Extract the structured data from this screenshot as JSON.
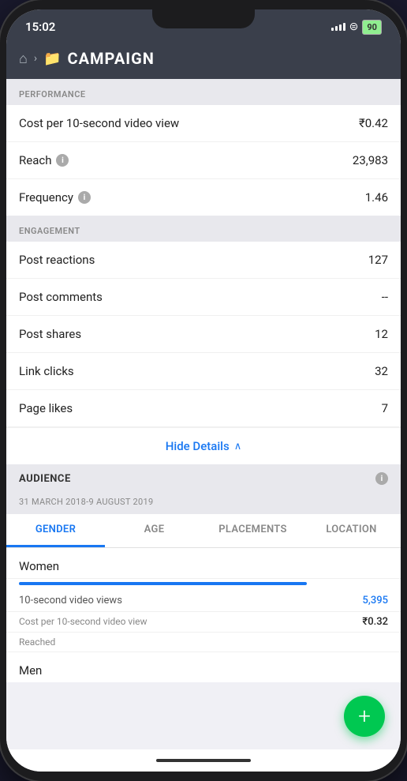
{
  "statusBar": {
    "time": "15:02",
    "battery": "90"
  },
  "header": {
    "title": "CAMPAIGN",
    "home_label": "Home",
    "folder_label": "Folder"
  },
  "performance": {
    "section_label": "PERFORMANCE",
    "metrics": [
      {
        "label": "Cost per 10-second video view",
        "value": "₹0.42",
        "has_info": false
      },
      {
        "label": "Reach",
        "value": "23,983",
        "has_info": true
      },
      {
        "label": "Frequency",
        "value": "1.46",
        "has_info": true
      }
    ]
  },
  "engagement": {
    "section_label": "ENGAGEMENT",
    "metrics": [
      {
        "label": "Post reactions",
        "value": "127",
        "has_info": false
      },
      {
        "label": "Post comments",
        "value": "--",
        "has_info": false
      },
      {
        "label": "Post shares",
        "value": "12",
        "has_info": false
      },
      {
        "label": "Link clicks",
        "value": "32",
        "has_info": false
      },
      {
        "label": "Page likes",
        "value": "7",
        "has_info": false
      }
    ]
  },
  "hideDetails": {
    "label": "Hide Details",
    "chevron": "∧"
  },
  "audience": {
    "title": "AUDIENCE",
    "date_range": "31 MARCH 2018-9 AUGUST 2019",
    "tabs": [
      {
        "label": "GENDER",
        "active": true
      },
      {
        "label": "AGE",
        "active": false
      },
      {
        "label": "PLACEMENTS",
        "active": false
      },
      {
        "label": "LOCATION",
        "active": false
      }
    ],
    "groups": [
      {
        "label": "Women",
        "bar_color": "#1877f2",
        "bar_width": "78%",
        "stats": [
          {
            "label": "10-second video views",
            "value": "5,395",
            "color": "blue"
          },
          {
            "label": "Cost per 10-second video view",
            "value": "₹0.32",
            "color": "dark"
          },
          {
            "label": "Reached",
            "value": "",
            "color": "dark"
          }
        ]
      },
      {
        "label": "Men",
        "bar_color": "#1877f2",
        "bar_width": "20%",
        "stats": []
      }
    ]
  },
  "fab": {
    "label": "+",
    "aria": "Add new"
  }
}
